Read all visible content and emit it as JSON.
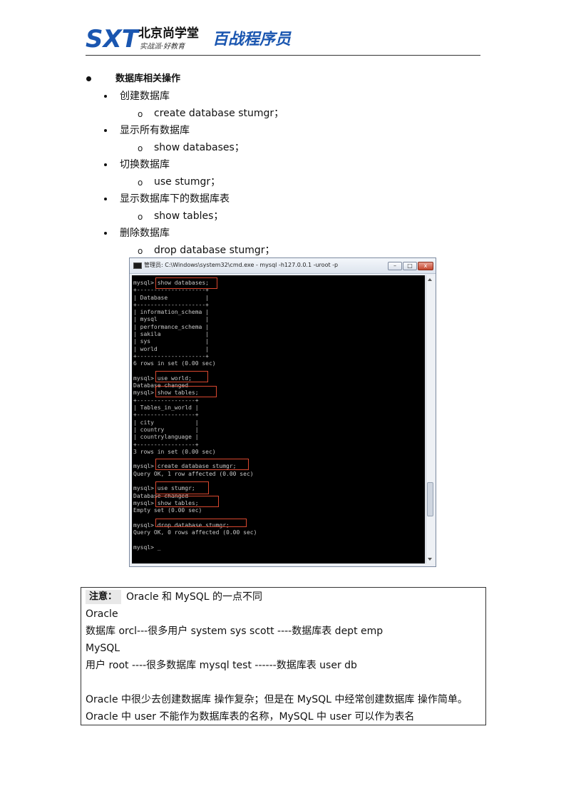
{
  "header": {
    "logo_sxt": "SXT",
    "logo_cn": "北京尚学堂",
    "logo_slogan": "实战派·好教育",
    "logo_brand": "百战程序员"
  },
  "outline": {
    "heading": "数据库相关操作",
    "items": [
      {
        "label": "创建数据库",
        "command": "create database stumgr；"
      },
      {
        "label": "显示所有数据库",
        "command": "show databases；"
      },
      {
        "label": "切换数据库",
        "command": "use stumgr；"
      },
      {
        "label": "显示数据库下的数据库表",
        "command": "show tables；"
      },
      {
        "label": "删除数据库",
        "command": "drop database stumgr；"
      }
    ],
    "sub_bullet": "o"
  },
  "terminal": {
    "title": "管理员: C:\\Windows\\system32\\cmd.exe - mysql  -h127.0.0.1 -uroot -p",
    "min_glyph": "–",
    "max_glyph": "□",
    "close_glyph": "x",
    "lines": [
      "mysql> show databases;",
      "+--------------------+",
      "| Database           |",
      "+--------------------+",
      "| information_schema |",
      "| mysql              |",
      "| performance_schema |",
      "| sakila             |",
      "| sys                |",
      "| world              |",
      "+--------------------+",
      "6 rows in set (0.00 sec)",
      "",
      "mysql> use world;",
      "Database changed",
      "mysql> show tables;",
      "+-----------------+",
      "| Tables_in_world |",
      "+-----------------+",
      "| city            |",
      "| country         |",
      "| countrylanguage |",
      "+-----------------+",
      "3 rows in set (0.00 sec)",
      "",
      "mysql> create database stumgr;",
      "Query OK, 1 row affected (0.00 sec)",
      "",
      "mysql> use stumgr;",
      "Database changed",
      "mysql> show tables;",
      "Empty set (0.00 sec)",
      "",
      "mysql> drop database stumgr;",
      "Query OK, 0 rows affected (0.00 sec)",
      "",
      "mysql> _"
    ],
    "highlight_color": "#d8472f"
  },
  "note": {
    "label": "注意：",
    "title": "Oracle 和 MySQL 的一点不同",
    "lines": [
      "Oracle",
      "数据库 orcl---很多用户 system sys   scott ----数据库表  dept emp",
      "MySQL",
      "用户 root ----很多数据库 mysql   test   ------数据库表   user   db",
      "",
      "Oracle 中很少去创建数据库   操作复杂；但是在 MySQL 中经常创建数据库    操作简单。",
      "Oracle 中 user 不能作为数据库表的名称，MySQL 中 user 可以作为表名"
    ]
  }
}
